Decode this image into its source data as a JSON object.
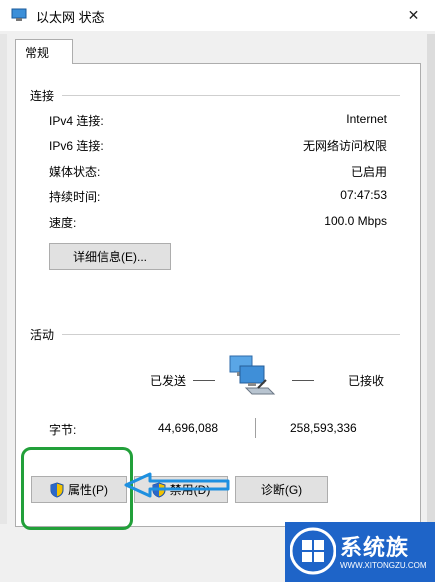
{
  "window": {
    "title": "以太网 状态",
    "close_glyph": "✕"
  },
  "tabs": [
    {
      "label": "常规"
    }
  ],
  "connection": {
    "heading": "连接",
    "rows": [
      {
        "label": "IPv4 连接:",
        "value": "Internet"
      },
      {
        "label": "IPv6 连接:",
        "value": "无网络访问权限"
      },
      {
        "label": "媒体状态:",
        "value": "已启用"
      },
      {
        "label": "持续时间:",
        "value": "07:47:53"
      },
      {
        "label": "速度:",
        "value": "100.0 Mbps"
      }
    ],
    "details_button": "详细信息(E)..."
  },
  "activity": {
    "heading": "活动",
    "sent_label": "已发送",
    "received_label": "已接收",
    "bytes_label": "字节:",
    "bytes_sent": "44,696,088",
    "bytes_received": "258,593,336"
  },
  "buttons": {
    "properties": "属性(P)",
    "disable": "禁用(D)",
    "diagnose": "诊断(G)"
  },
  "watermark": {
    "text": "系统族",
    "url": "WWW.XITONGZU.COM"
  },
  "colors": {
    "highlight_box": "#22a03a",
    "arrow": "#1e90e0",
    "logo_bg": "#1e64c8"
  }
}
